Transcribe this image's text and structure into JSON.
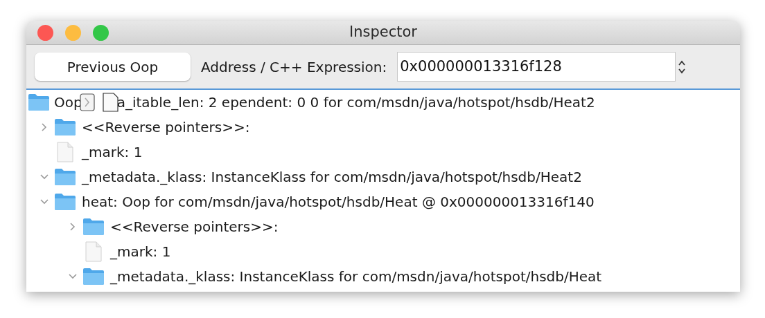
{
  "window": {
    "title": "Inspector"
  },
  "toolbar": {
    "previous_button": "Previous Oop",
    "address_label": "Address / C++ Expression:",
    "address_value": "0x000000013316f128"
  },
  "tree": {
    "root": {
      "label_start": "Oop",
      "label_rest": "a_itable_len: 2 ependent: 0 0 for com/msdn/java/hotspot/hsdb/Heat2",
      "children": [
        {
          "label": "<<Reverse pointers>>:",
          "kind": "folder",
          "expanded": false
        },
        {
          "label": "_mark: 1",
          "kind": "leaf"
        },
        {
          "label": "_metadata._klass: InstanceKlass for com/msdn/java/hotspot/hsdb/Heat2",
          "kind": "folder",
          "expanded": true
        },
        {
          "label": "heat: Oop for com/msdn/java/hotspot/hsdb/Heat @ 0x000000013316f140",
          "kind": "folder",
          "expanded": true,
          "children": [
            {
              "label": "<<Reverse pointers>>:",
              "kind": "folder",
              "expanded": false
            },
            {
              "label": "_mark: 1",
              "kind": "leaf"
            },
            {
              "label": "_metadata._klass: InstanceKlass for com/msdn/java/hotspot/hsdb/Heat",
              "kind": "folder",
              "expanded": true
            }
          ]
        }
      ]
    }
  }
}
